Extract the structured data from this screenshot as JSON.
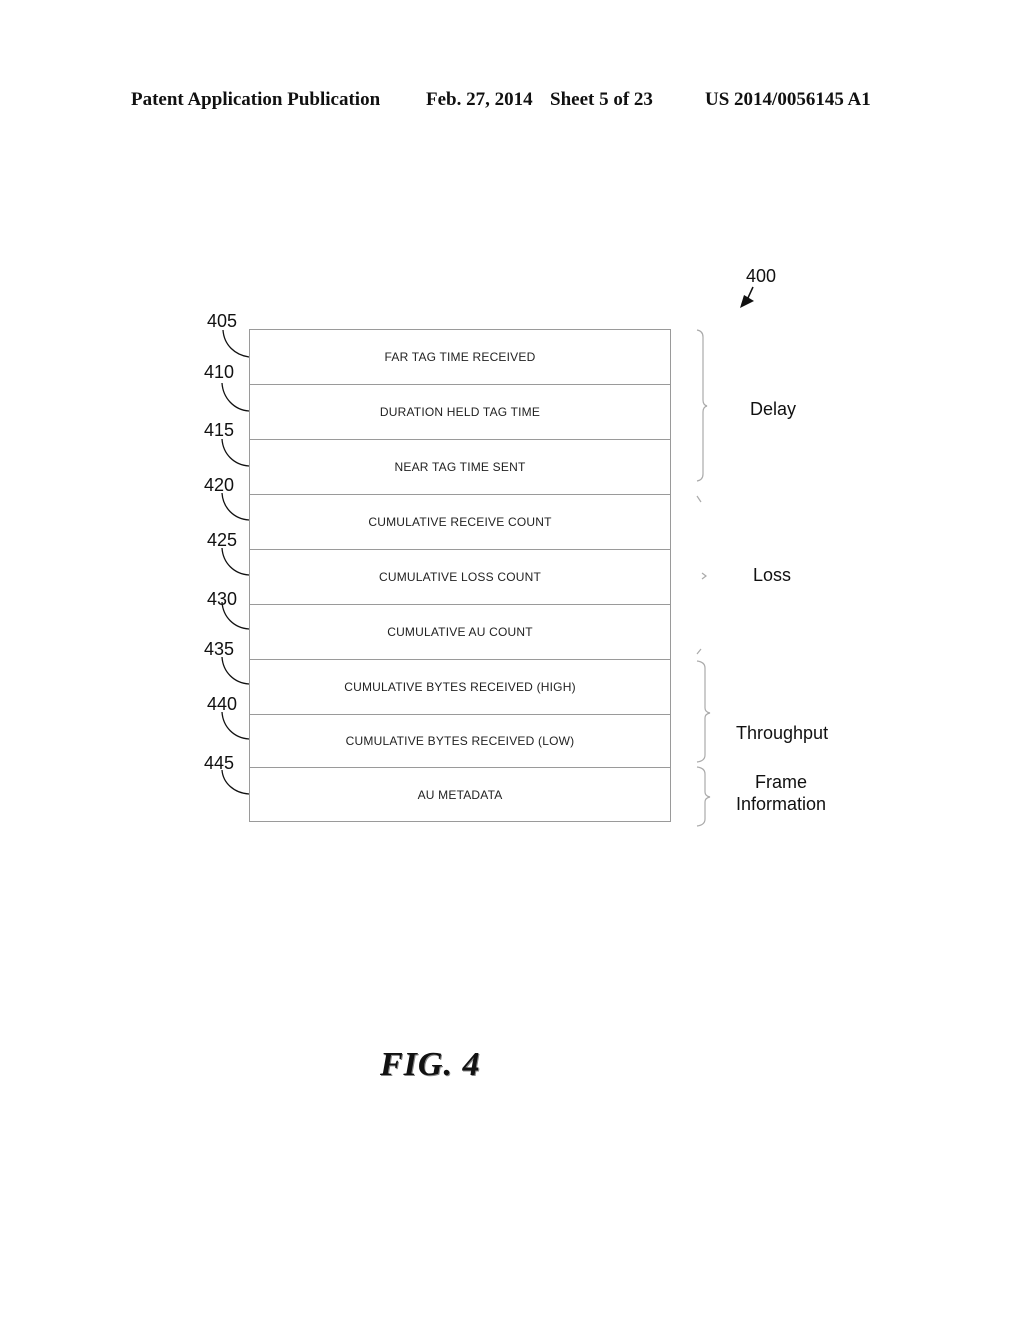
{
  "header": {
    "publication": "Patent Application Publication",
    "date": "Feb. 27, 2014",
    "sheet": "Sheet 5 of 23",
    "number": "US 2014/0056145 A1"
  },
  "figure": {
    "ref": "400",
    "caption": "FIG. 4",
    "fields": [
      {
        "ref": "405",
        "label": "FAR TAG TIME RECEIVED"
      },
      {
        "ref": "410",
        "label": "DURATION HELD TAG TIME"
      },
      {
        "ref": "415",
        "label": "NEAR TAG TIME SENT"
      },
      {
        "ref": "420",
        "label": "CUMULATIVE RECEIVE COUNT"
      },
      {
        "ref": "425",
        "label": "CUMULATIVE LOSS COUNT"
      },
      {
        "ref": "430",
        "label": "CUMULATIVE AU COUNT"
      },
      {
        "ref": "435",
        "label": "CUMULATIVE BYTES RECEIVED (HIGH)"
      },
      {
        "ref": "440",
        "label": "CUMULATIVE BYTES RECEIVED (LOW)"
      },
      {
        "ref": "445",
        "label": "AU METADATA"
      }
    ],
    "groups": [
      {
        "label": "Delay"
      },
      {
        "label": "Loss"
      },
      {
        "label": "Throughput"
      },
      {
        "label_line1": "Frame",
        "label_line2": "Information"
      }
    ]
  }
}
